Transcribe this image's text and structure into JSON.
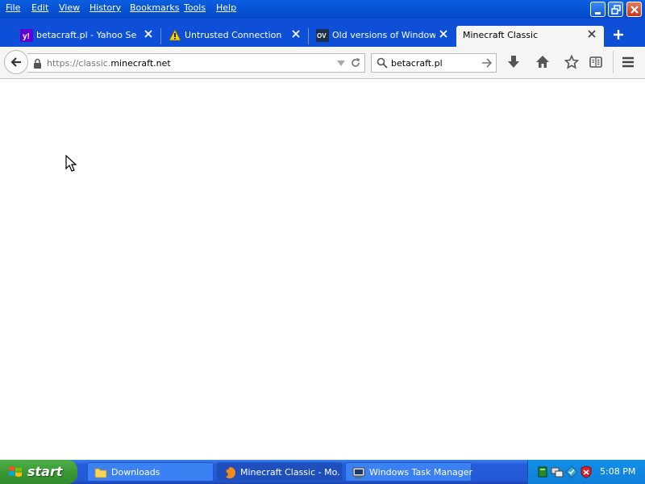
{
  "menu": [
    {
      "label": "File"
    },
    {
      "label": "Edit"
    },
    {
      "label": "View"
    },
    {
      "label": "History"
    },
    {
      "label": "Bookmarks"
    },
    {
      "label": "Tools"
    },
    {
      "label": "Help"
    }
  ],
  "tabs": [
    {
      "title": "betacraft.pl - Yahoo Se...",
      "icon": "yahoo-icon"
    },
    {
      "title": "Untrusted Connection",
      "icon": "warning-icon"
    },
    {
      "title": "Old versions of Window...",
      "icon": "oldversion-icon",
      "icon_text": "OV"
    },
    {
      "title": "Minecraft Classic",
      "icon": "none",
      "active": true
    }
  ],
  "urlbar": {
    "prefix": "https://classic.",
    "domain": "minecraft.net",
    "suffix": ".net"
  },
  "searchbar": {
    "value": "betacraft.pl"
  },
  "taskbar": {
    "start_label": "start",
    "tasks": [
      {
        "label": "Downloads",
        "icon": "folder-icon"
      },
      {
        "label": "Minecraft Classic - Mo...",
        "icon": "firefox-icon",
        "active": true
      },
      {
        "label": "Windows Task Manager",
        "icon": "task-manager-icon"
      }
    ],
    "clock": "5:08 PM"
  },
  "colors": {
    "xp_blue": "#0548c9",
    "start_green": "#3a9a36",
    "tray_blue": "#0f7fd9"
  }
}
